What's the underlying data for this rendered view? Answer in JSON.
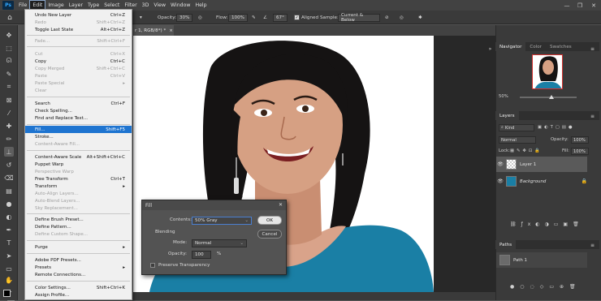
{
  "menubar": {
    "logo": "Ps",
    "items": [
      "File",
      "Edit",
      "Image",
      "Layer",
      "Type",
      "Select",
      "Filter",
      "3D",
      "View",
      "Window",
      "Help"
    ],
    "window_controls": [
      "—",
      "❐",
      "✕"
    ]
  },
  "options_bar": {
    "opacity_label": "Opacity:",
    "opacity_value": "30%",
    "flow_label": "Flow:",
    "flow_value": "100%",
    "angle_value": "67°",
    "aligned_label": "Aligned",
    "sample_label": "Sample:",
    "sample_value": "Current & Below"
  },
  "document_tab": {
    "label": "r 1, RGB/8*) *",
    "close": "×"
  },
  "edit_menu": {
    "items": [
      {
        "label": "Undo New Layer",
        "shortcut": "Ctrl+Z",
        "state": "enabled"
      },
      {
        "label": "Redo",
        "shortcut": "Shift+Ctrl+Z",
        "state": "disabled"
      },
      {
        "label": "Toggle Last State",
        "shortcut": "Alt+Ctrl+Z",
        "state": "enabled"
      },
      {
        "label": "Fade...",
        "shortcut": "Shift+Ctrl+F",
        "state": "disabled"
      },
      {
        "label": "Cut",
        "shortcut": "Ctrl+X",
        "state": "disabled"
      },
      {
        "label": "Copy",
        "shortcut": "Ctrl+C",
        "state": "enabled"
      },
      {
        "label": "Copy Merged",
        "shortcut": "Shift+Ctrl+C",
        "state": "disabled"
      },
      {
        "label": "Paste",
        "shortcut": "Ctrl+V",
        "state": "disabled"
      },
      {
        "label": "Paste Special",
        "shortcut": "▸",
        "state": "disabled"
      },
      {
        "label": "Clear",
        "shortcut": "",
        "state": "disabled"
      },
      {
        "label": "Search",
        "shortcut": "Ctrl+F",
        "state": "enabled"
      },
      {
        "label": "Check Spelling...",
        "shortcut": "",
        "state": "enabled"
      },
      {
        "label": "Find and Replace Text...",
        "shortcut": "",
        "state": "enabled"
      },
      {
        "label": "Fill...",
        "shortcut": "Shift+F5",
        "state": "highlighted"
      },
      {
        "label": "Stroke...",
        "shortcut": "",
        "state": "enabled"
      },
      {
        "label": "Content-Aware Fill...",
        "shortcut": "",
        "state": "disabled"
      },
      {
        "label": "Content-Aware Scale",
        "shortcut": "Alt+Shift+Ctrl+C",
        "state": "enabled"
      },
      {
        "label": "Puppet Warp",
        "shortcut": "",
        "state": "enabled"
      },
      {
        "label": "Perspective Warp",
        "shortcut": "",
        "state": "disabled"
      },
      {
        "label": "Free Transform",
        "shortcut": "Ctrl+T",
        "state": "enabled"
      },
      {
        "label": "Transform",
        "shortcut": "▸",
        "state": "enabled"
      },
      {
        "label": "Auto-Align Layers...",
        "shortcut": "",
        "state": "disabled"
      },
      {
        "label": "Auto-Blend Layers...",
        "shortcut": "",
        "state": "disabled"
      },
      {
        "label": "Sky Replacement...",
        "shortcut": "",
        "state": "disabled"
      },
      {
        "label": "Define Brush Preset...",
        "shortcut": "",
        "state": "enabled"
      },
      {
        "label": "Define Pattern...",
        "shortcut": "",
        "state": "enabled"
      },
      {
        "label": "Define Custom Shape...",
        "shortcut": "",
        "state": "disabled"
      },
      {
        "label": "Purge",
        "shortcut": "▸",
        "state": "enabled"
      },
      {
        "label": "Adobe PDF Presets...",
        "shortcut": "",
        "state": "enabled"
      },
      {
        "label": "Presets",
        "shortcut": "▸",
        "state": "enabled"
      },
      {
        "label": "Remote Connections...",
        "shortcut": "",
        "state": "enabled"
      },
      {
        "label": "Color Settings...",
        "shortcut": "Shift+Ctrl+K",
        "state": "enabled"
      },
      {
        "label": "Assign Profile...",
        "shortcut": "",
        "state": "enabled"
      }
    ]
  },
  "fill_dialog": {
    "title": "Fill",
    "close": "✕",
    "contents_label": "Contents:",
    "contents_value": "50% Gray",
    "ok_label": "OK",
    "cancel_label": "Cancel",
    "blending_label": "Blending",
    "mode_label": "Mode:",
    "mode_value": "Normal",
    "opacity_label": "Opacity:",
    "opacity_value": "100",
    "opacity_unit": "%",
    "preserve_label": "Preserve Transparency"
  },
  "navigator": {
    "tabs": [
      "Navigator",
      "Color",
      "Swatches"
    ],
    "zoom": "50%"
  },
  "layers_panel": {
    "title": "Layers",
    "filter_value": "Kind",
    "blend_mode": "Normal",
    "opacity_label": "Opacity:",
    "opacity_value": "100%",
    "lock_label": "Lock:",
    "fill_label": "Fill:",
    "fill_value": "100%",
    "layers": [
      {
        "name": "Layer 1",
        "selected": true
      },
      {
        "name": "Background",
        "selected": false
      }
    ]
  },
  "paths_panel": {
    "title": "Paths",
    "paths": [
      "Path 1"
    ]
  },
  "colors": {
    "accent": "#1e74d0",
    "ui_dark": "#3a3a3a",
    "shirt": "#1a7fa5"
  }
}
